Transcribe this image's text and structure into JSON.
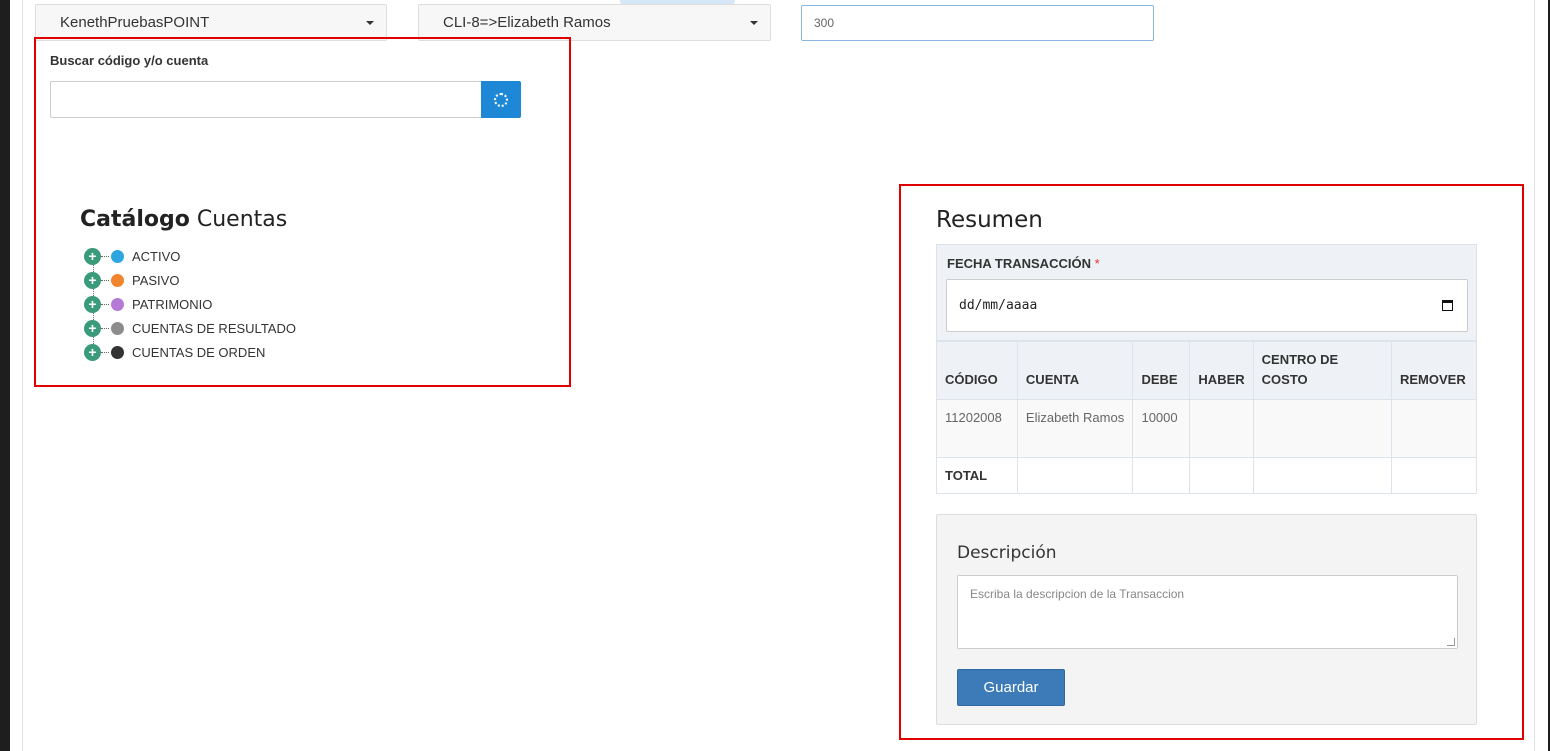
{
  "top": {
    "company_select": "KenethPruebasPOINT",
    "client_select": "CLI-8=>Elizabeth Ramos",
    "amount_value": "300"
  },
  "search": {
    "label": "Buscar código y/o cuenta",
    "value": ""
  },
  "catalog": {
    "title_bold": "Catálogo",
    "title_rest": "Cuentas",
    "nodes": [
      {
        "label": "ACTIVO",
        "color": "#2ea6e0"
      },
      {
        "label": "PASIVO",
        "color": "#f0852d"
      },
      {
        "label": "PATRIMONIO",
        "color": "#b57ad6"
      },
      {
        "label": "CUENTAS DE RESULTADO",
        "color": "#8c8c8c"
      },
      {
        "label": "CUENTAS DE ORDEN",
        "color": "#333333"
      }
    ]
  },
  "summary": {
    "title": "Resumen",
    "date_label": "FECHA TRANSACCIÓN",
    "date_required_mark": "*",
    "date_placeholder": "dd/mm/aaaa",
    "columns": [
      "CÓDIGO",
      "CUENTA",
      "DEBE",
      "HABER",
      "CENTRO DE COSTO",
      "REMOVER"
    ],
    "rows": [
      {
        "codigo": "11202008",
        "cuenta": "Elizabeth Ramos",
        "debe": "10000",
        "haber": "",
        "centro": "",
        "remover": ""
      }
    ],
    "total_label": "TOTAL"
  },
  "description": {
    "label": "Descripción",
    "placeholder": "Escriba la descripcion de la Transaccion",
    "save_label": "Guardar"
  }
}
